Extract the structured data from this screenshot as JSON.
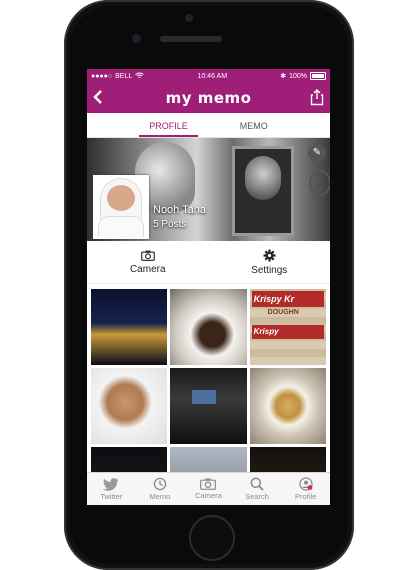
{
  "status_bar": {
    "carrier": "BELL",
    "time": "10:46 AM",
    "battery": "100%"
  },
  "header": {
    "title": "my memo",
    "back_icon": "back-chevron-icon",
    "share_icon": "share-icon"
  },
  "tabs": [
    {
      "label": "PROFILE",
      "active": true
    },
    {
      "label": "MEMO",
      "active": false
    }
  ],
  "profile": {
    "name": "Nooh Taha",
    "posts": "5 Posts"
  },
  "actions": [
    {
      "label": "Camera",
      "icon": "camera-icon"
    },
    {
      "label": "Settings",
      "icon": "gear-icon"
    }
  ],
  "photo_tiles": {
    "krispy_top": "Krispy Kr",
    "krispy_sub": "DOUGHN",
    "krispy_second": "Krispy"
  },
  "tab_bar": [
    {
      "label": "Twitter",
      "icon": "twitter-bird-icon"
    },
    {
      "label": "Memo",
      "icon": "history-icon"
    },
    {
      "label": "Camera",
      "icon": "camera-icon"
    },
    {
      "label": "Search",
      "icon": "search-icon"
    },
    {
      "label": "Profile",
      "icon": "profile-icon"
    }
  ],
  "colors": {
    "brand": "#9e1e78"
  }
}
